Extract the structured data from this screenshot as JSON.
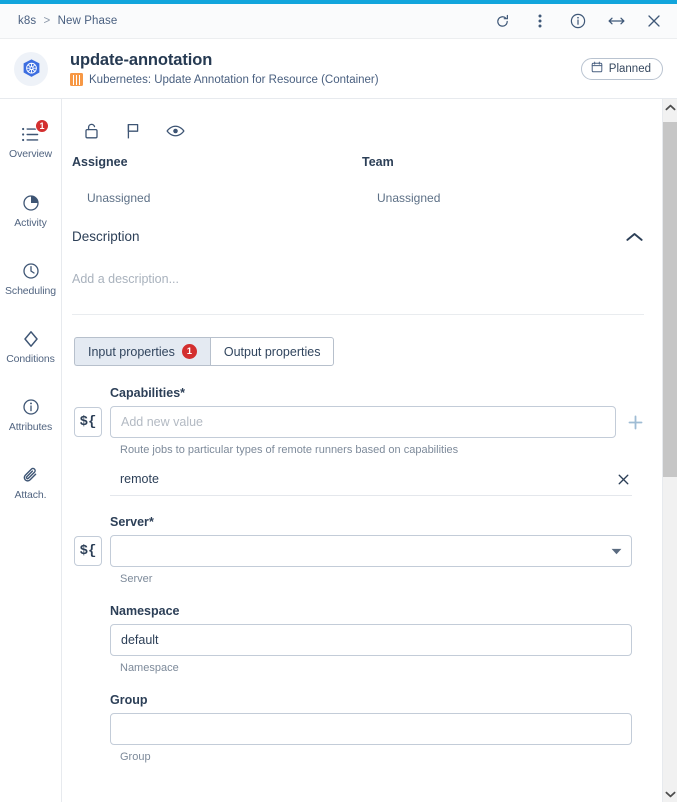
{
  "window": {
    "breadcrumb": {
      "root": "k8s",
      "separator": ">",
      "current": "New Phase"
    },
    "actions": [
      {
        "name": "refresh-icon",
        "label": "Refresh"
      },
      {
        "name": "more-vertical-icon",
        "label": "More options"
      },
      {
        "name": "info-icon",
        "label": "Info"
      },
      {
        "name": "resize-horizontal-icon",
        "label": "Resize"
      },
      {
        "name": "close-icon",
        "label": "Close"
      }
    ]
  },
  "header": {
    "logo": "kubernetes-logo",
    "title": "update-annotation",
    "subtitle": "Kubernetes: Update Annotation for Resource (Container)",
    "subtitle_icon": "plugin-icon",
    "status": {
      "label": "Planned",
      "icon": "calendar-icon"
    }
  },
  "sidebar": {
    "items": [
      {
        "label": "Overview",
        "icon": "list-icon",
        "badge": "1",
        "active": true
      },
      {
        "label": "Activity",
        "icon": "pie-chart-icon",
        "badge": null,
        "active": false
      },
      {
        "label": "Scheduling",
        "icon": "clock-icon",
        "badge": null,
        "active": false
      },
      {
        "label": "Conditions",
        "icon": "diamond-icon",
        "badge": null,
        "active": false
      },
      {
        "label": "Attributes",
        "icon": "info-circle-icon",
        "badge": null,
        "active": false
      },
      {
        "label": "Attach.",
        "icon": "paperclip-icon",
        "badge": null,
        "active": false
      }
    ]
  },
  "toolbar": {
    "icons": [
      {
        "name": "unlock-icon",
        "label": "Lock"
      },
      {
        "name": "flag-icon",
        "label": "Flag"
      },
      {
        "name": "eye-icon",
        "label": "Watch"
      }
    ]
  },
  "details": {
    "assignee": {
      "label": "Assignee",
      "value": "Unassigned"
    },
    "team": {
      "label": "Team",
      "value": "Unassigned"
    }
  },
  "description": {
    "title": "Description",
    "placeholder": "Add a description...",
    "collapse_icon": "chevron-up-icon",
    "expanded": true
  },
  "tabs": [
    {
      "label": "Input properties",
      "badge": "1",
      "active": true
    },
    {
      "label": "Output properties",
      "badge": null,
      "active": false
    }
  ],
  "form": {
    "fields": [
      {
        "key": "capabilities",
        "label": "Capabilities",
        "required": "*",
        "type": "multi-value",
        "value": "",
        "placeholder": "Add new value",
        "help": "Route jobs to particular types of remote runners based on capabilities",
        "var_button": "${",
        "add_button": "plus-icon",
        "chips": [
          {
            "text": "remote",
            "remove_icon": "close-icon"
          }
        ]
      },
      {
        "key": "server",
        "label": "Server",
        "required": "*",
        "type": "select",
        "value": "",
        "placeholder": "",
        "help": "Server",
        "var_button": "${",
        "caret": "chevron-down-icon"
      },
      {
        "key": "namespace",
        "label": "Namespace",
        "required": "",
        "type": "text",
        "value": "default",
        "placeholder": "",
        "help": "Namespace"
      },
      {
        "key": "group",
        "label": "Group",
        "required": "",
        "type": "text",
        "value": "",
        "placeholder": "",
        "help": "Group"
      }
    ]
  },
  "scrollbar": {
    "up_icon": "chevron-up-icon",
    "down_icon": "chevron-down-icon"
  },
  "colors": {
    "accent": "#12a5dc",
    "badge": "#d32f2f",
    "plugin": "#f79845",
    "text": "#2c3f57"
  }
}
